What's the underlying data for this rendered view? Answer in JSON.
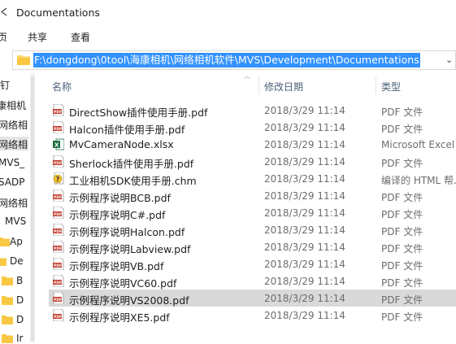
{
  "window": {
    "title": "Documentations"
  },
  "ribbon": {
    "tabs": [
      "页",
      "共享",
      "查看"
    ]
  },
  "address": {
    "path": "F:\\dongdong\\0tool\\海康相机\\网络相机软件\\MVS\\Development\\Documentations"
  },
  "nav": {
    "items": [
      "钉",
      "康相机",
      "网络相",
      "网络相",
      "MVS_",
      "SADP",
      "网络相",
      "MVS",
      "Ap",
      "De",
      "B",
      "D",
      "D",
      "Ir"
    ]
  },
  "columns": {
    "name": "名称",
    "date": "修改日期",
    "type": "类型"
  },
  "files": [
    {
      "name": "DirectShow插件使用手册.pdf",
      "date": "2018/3/29 11:14",
      "type": "PDF 文件",
      "icon": "pdf-icon"
    },
    {
      "name": "Halcon插件使用手册.pdf",
      "date": "2018/3/29 11:14",
      "type": "PDF 文件",
      "icon": "pdf-icon"
    },
    {
      "name": "MvCameraNode.xlsx",
      "date": "2018/3/29 11:14",
      "type": "Microsoft Excel",
      "icon": "excel-icon"
    },
    {
      "name": "Sherlock插件使用手册.pdf",
      "date": "2018/3/29 11:14",
      "type": "PDF 文件",
      "icon": "pdf-icon"
    },
    {
      "name": "工业相机SDK使用手册.chm",
      "date": "2018/3/29 11:14",
      "type": "编译的 HTML 帮...",
      "icon": "chm-help-icon"
    },
    {
      "name": "示例程序说明BCB.pdf",
      "date": "2018/3/29 11:14",
      "type": "PDF 文件",
      "icon": "pdf-icon"
    },
    {
      "name": "示例程序说明C#.pdf",
      "date": "2018/3/29 11:14",
      "type": "PDF 文件",
      "icon": "pdf-icon"
    },
    {
      "name": "示例程序说明Halcon.pdf",
      "date": "2018/3/29 11:14",
      "type": "PDF 文件",
      "icon": "pdf-icon"
    },
    {
      "name": "示例程序说明Labview.pdf",
      "date": "2018/3/29 11:14",
      "type": "PDF 文件",
      "icon": "pdf-icon"
    },
    {
      "name": "示例程序说明VB.pdf",
      "date": "2018/3/29 11:14",
      "type": "PDF 文件",
      "icon": "pdf-icon"
    },
    {
      "name": "示例程序说明VC60.pdf",
      "date": "2018/3/29 11:14",
      "type": "PDF 文件",
      "icon": "pdf-icon"
    },
    {
      "name": "示例程序说明VS2008.pdf",
      "date": "2018/3/29 11:14",
      "type": "PDF 文件",
      "icon": "pdf-icon",
      "selected": true
    },
    {
      "name": "示例程序说明XE5.pdf",
      "date": "2018/3/29 11:14",
      "type": "PDF 文件",
      "icon": "pdf-icon"
    }
  ],
  "colors": {
    "selection": "#d9d9d9",
    "address_highlight": "#3392ff",
    "pdf_red": "#c0392b",
    "excel_green": "#1e7145"
  }
}
